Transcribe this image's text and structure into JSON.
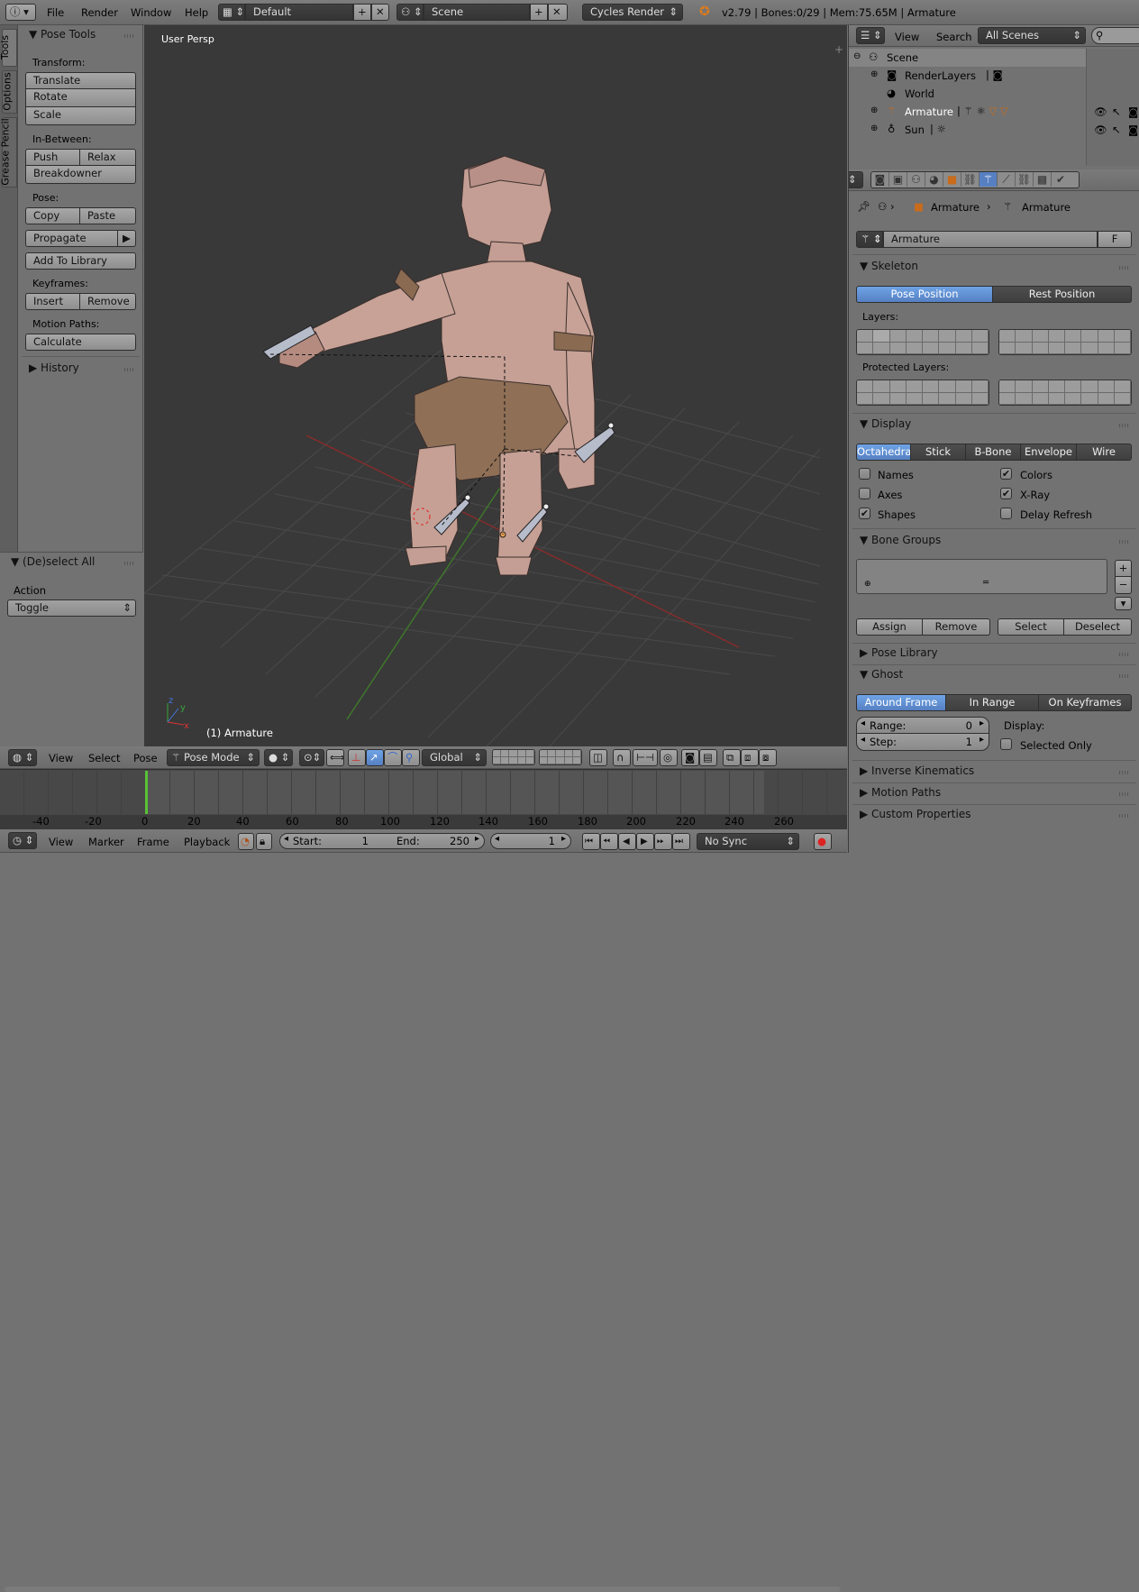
{
  "topbar": {
    "menus": [
      "File",
      "Render",
      "Window",
      "Help"
    ],
    "layout": "Default",
    "scene": "Scene",
    "engine": "Cycles Render",
    "stats": "v2.79 | Bones:0/29  | Mem:75.65M | Armature"
  },
  "left_tabs": [
    "Tools",
    "Options",
    "Grease Pencil"
  ],
  "pose_tools": {
    "title": "Pose Tools",
    "transform_label": "Transform:",
    "translate": "Translate",
    "rotate": "Rotate",
    "scale": "Scale",
    "inbetween_label": "In-Between:",
    "push": "Push",
    "relax": "Relax",
    "breakdowner": "Breakdowner",
    "pose_label": "Pose:",
    "copy": "Copy",
    "paste": "Paste",
    "propagate": "Propagate",
    "add_to_library": "Add To Library",
    "keyframes_label": "Keyframes:",
    "insert": "Insert",
    "remove": "Remove",
    "motion_paths_label": "Motion Paths:",
    "calculate": "Calculate",
    "history": "History"
  },
  "operator": {
    "title": "(De)select All",
    "action_label": "Action",
    "action_value": "Toggle"
  },
  "viewport": {
    "view_name": "User Persp",
    "object_label": "(1) Armature"
  },
  "viewport_header": {
    "view": "View",
    "select": "Select",
    "pose": "Pose",
    "mode": "Pose Mode",
    "orientation": "Global"
  },
  "outliner": {
    "view": "View",
    "search": "Search",
    "filter": "All Scenes",
    "items": [
      "Scene",
      "RenderLayers",
      "World",
      "Armature",
      "Sun"
    ]
  },
  "properties": {
    "breadcrumb_1": "Armature",
    "breadcrumb_2": "Armature",
    "datablock_name": "Armature",
    "fake_user": "F",
    "skeleton": {
      "title": "Skeleton",
      "pose_position": "Pose Position",
      "rest_position": "Rest Position",
      "layers_label": "Layers:",
      "protected_label": "Protected Layers:"
    },
    "display": {
      "title": "Display",
      "modes": [
        "Octahedral",
        "Stick",
        "B-Bone",
        "Envelope",
        "Wire"
      ],
      "names": "Names",
      "axes": "Axes",
      "shapes": "Shapes",
      "colors": "Colors",
      "xray": "X-Ray",
      "delay_refresh": "Delay Refresh"
    },
    "bone_groups": {
      "title": "Bone Groups",
      "assign": "Assign",
      "remove": "Remove",
      "select": "Select",
      "deselect": "Deselect"
    },
    "pose_library": "Pose Library",
    "ghost": {
      "title": "Ghost",
      "around_frame": "Around Frame",
      "in_range": "In Range",
      "on_keyframes": "On Keyframes",
      "range_label": "Range:",
      "range_value": "0",
      "step_label": "Step:",
      "step_value": "1",
      "display_label": "Display:",
      "selected_only": "Selected Only"
    },
    "inverse_kinematics": "Inverse Kinematics",
    "motion_paths": "Motion Paths",
    "custom_properties": "Custom Properties"
  },
  "timeline": {
    "ticks": [
      "-40",
      "-20",
      "0",
      "20",
      "40",
      "60",
      "80",
      "100",
      "120",
      "140",
      "160",
      "180",
      "200",
      "220",
      "240",
      "260"
    ],
    "view": "View",
    "marker": "Marker",
    "frame": "Frame",
    "playback": "Playback",
    "start_label": "Start:",
    "start_value": "1",
    "end_label": "End:",
    "end_value": "250",
    "current_frame": "1",
    "sync": "No Sync"
  }
}
